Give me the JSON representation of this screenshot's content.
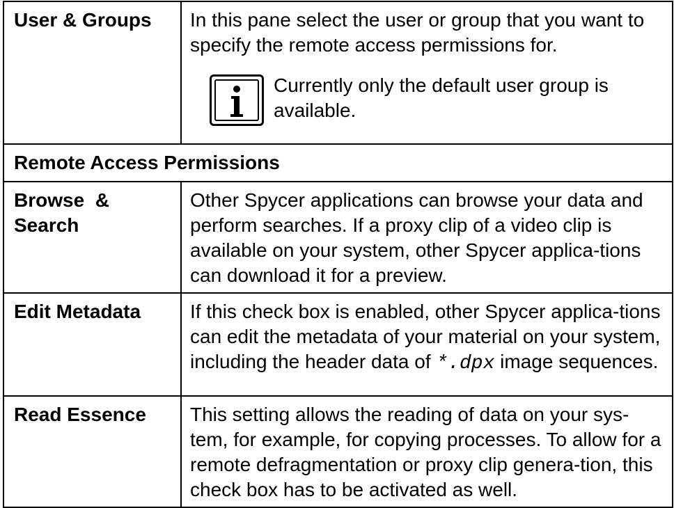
{
  "rows": {
    "user_groups": {
      "term": "User & Groups",
      "desc": "In this pane select the user or group that you want to specify the remote access permissions for.",
      "note": {
        "icon": "info-icon",
        "text": "Currently only the default user group is available."
      }
    },
    "section_header": "Remote Access Permissions",
    "browse_search": {
      "term_line1": "Browse  &",
      "term_line2": "Search",
      "desc": "Other Spycer applications can browse your data and perform searches. If a proxy clip of a video clip is available on your system, other Spycer applica-tions can download it for a preview."
    },
    "edit_metadata": {
      "term": "Edit Metadata",
      "desc_before": "If this check box is enabled, other Spycer applica-tions can edit the metadata of your material on your system, including the header data of ",
      "desc_code": "*.dpx",
      "desc_after": " image sequences."
    },
    "read_essence": {
      "term": "Read Essence",
      "desc": "This setting allows the reading of data on your sys-tem, for example, for copying processes. To allow for a remote defragmentation or proxy clip genera-tion, this check box has to be activated as well."
    }
  }
}
